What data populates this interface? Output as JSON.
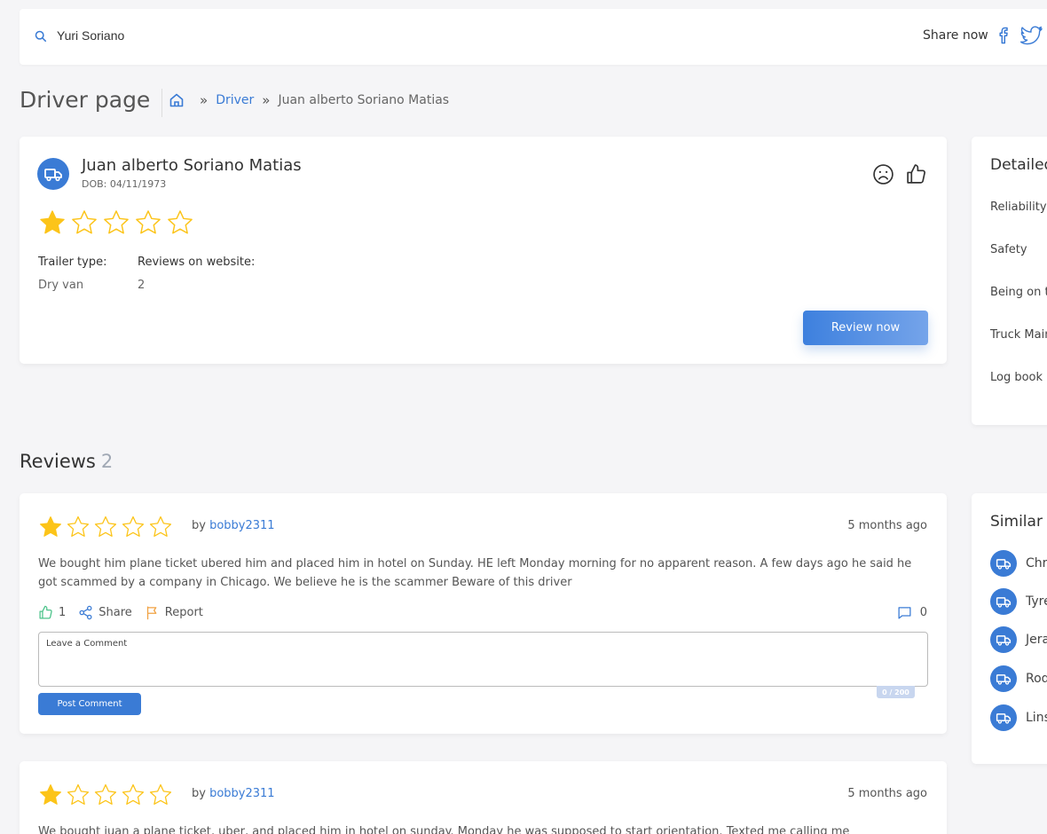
{
  "topbar": {
    "search_value": "Yuri Soriano",
    "share_label": "Share now"
  },
  "page": {
    "title": "Driver page"
  },
  "breadcrumb": {
    "items": [
      "Driver",
      "Juan alberto Soriano Matias"
    ]
  },
  "driver": {
    "name": "Juan alberto Soriano Matias",
    "dob": "DOB: 04/11/1973",
    "rating": 1,
    "max_rating": 5,
    "trailer_type_label": "Trailer type:",
    "trailer_type_value": "Dry van",
    "reviews_label": "Reviews on website:",
    "reviews_value": "2",
    "review_button": "Review now"
  },
  "details": {
    "title": "Detailed",
    "items": [
      "Reliability",
      "Safety",
      "Being on time",
      "Truck Maintenance",
      "Log book"
    ]
  },
  "reviews_section": {
    "heading": "Reviews",
    "count": "2"
  },
  "reviews": [
    {
      "rating": 1,
      "by_label": "by",
      "user": "bobby2311",
      "time": "5 months ago",
      "text": "We bought him plane ticket ubered him and placed him in hotel on Sunday. HE left Monday morning for no apparent reason. A few days ago he said he got scammed by a company in Chicago. We believe he is the scammer Beware of this driver",
      "likes": "1",
      "share_label": "Share",
      "report_label": "Report",
      "comments": "0",
      "comment_placeholder": "Leave a Comment",
      "char_counter": "0 / 200",
      "post_button": "Post Comment"
    },
    {
      "rating": 1,
      "by_label": "by",
      "user": "bobby2311",
      "time": "5 months ago",
      "text": "We bought juan a plane ticket, uber, and placed him in hotel on sunday. Monday he was supposed to start orientation. Texted me calling me"
    }
  ],
  "similar": {
    "title": "Similar drivers",
    "items": [
      "Christopher",
      "Tyrell",
      "Jeral",
      "Rodney",
      "Linsey"
    ]
  },
  "colors": {
    "accent": "#3a7bd5",
    "star": "#fcc419",
    "like": "#4cc38a",
    "report": "#f0a243"
  }
}
